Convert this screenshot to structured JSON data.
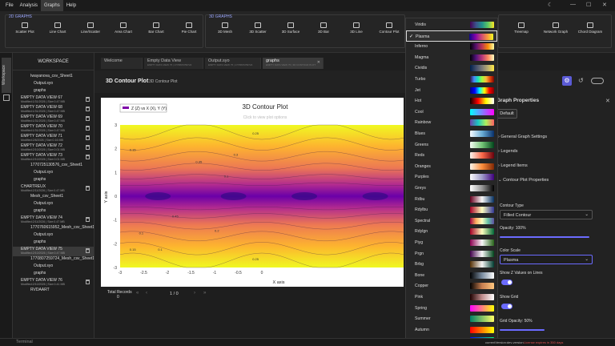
{
  "menubar": {
    "items": [
      "File",
      "Analysis",
      "Graphs",
      "Help"
    ],
    "active": "Graphs"
  },
  "ribbon": {
    "group2d": "2D GRAPHS",
    "group3d": "3D GRAPHS",
    "buttons2d": [
      "Scatter Plot",
      "Line Chart",
      "Line/Scatter",
      "Area Chart",
      "Bar Chart",
      "Pie Chart"
    ],
    "buttons3d": [
      "3D Mesh",
      "3D Scatter",
      "3D Surface",
      "3D Bar",
      "3D Line",
      "Contour Plot"
    ],
    "buttonsRight": [
      "Treemap",
      "Network Graph",
      "Chord Diagram"
    ]
  },
  "leftbar": {
    "workspace_tab": "Workspace"
  },
  "workspace": {
    "title": "WORKSPACE",
    "items": [
      {
        "label": "Iwayanova_csv_Sheet1",
        "sub": ""
      },
      {
        "label": "Output.syo",
        "sub": ""
      },
      {
        "label": "graphs",
        "sub": ""
      },
      {
        "label": "EMPTY DATA VIEW 67",
        "sub": "Modified:1/31/2026 | Size:0.47 MB"
      },
      {
        "label": "EMPTY DATA VIEW 68",
        "sub": "Modified:1/31/2026 | Size:0.47 MB"
      },
      {
        "label": "EMPTY DATA VIEW 69",
        "sub": "Modified:1/31/2026 | Size:0.47 MB"
      },
      {
        "label": "EMPTY DATA VIEW 70",
        "sub": "Modified:1/31/2026 | Size:0.47 MB"
      },
      {
        "label": "EMPTY DATA VIEW 71",
        "sub": "Modified:2/8/2026 | Size:0.16 MB"
      },
      {
        "label": "EMPTY DATA VIEW 72",
        "sub": "Modified:2/10/2026 | Size:0.01 MB"
      },
      {
        "label": "EMPTY DATA VIEW 73",
        "sub": "Modified:2/10/2026 | Size:0.01 MB"
      },
      {
        "label": "1770725130576_csv_Sheet1",
        "sub": ""
      },
      {
        "label": "Output.syo",
        "sub": ""
      },
      {
        "label": "graphs",
        "sub": ""
      },
      {
        "label": "CHARTREUX",
        "sub": "Modified:2/11/2026 | Size:0.47 MB"
      },
      {
        "label": "Mesh_csv_Sheet1",
        "sub": ""
      },
      {
        "label": "Output.syo",
        "sub": ""
      },
      {
        "label": "graphs",
        "sub": ""
      },
      {
        "label": "EMPTY DATA VIEW 74",
        "sub": "Modified:2/11/2026 | Size:0.47 MB"
      },
      {
        "label": "1770760615952_Mesh_csv_Sheet1",
        "sub": ""
      },
      {
        "label": "Output.syo",
        "sub": ""
      },
      {
        "label": "graphs",
        "sub": ""
      },
      {
        "label": "EMPTY DATA VIEW 75",
        "sub": "Modified:2/10/2026 | Size:0.47 MB"
      },
      {
        "label": "1770807259724_Mesh_csv_Sheet1",
        "sub": ""
      },
      {
        "label": "Output.syo",
        "sub": ""
      },
      {
        "label": "graphs",
        "sub": ""
      },
      {
        "label": "EMPTY DATA VIEW 76",
        "sub": "Modified:2/10/2026 | Size:0.41 MB"
      },
      {
        "label": "RVDAART",
        "sub": ""
      }
    ]
  },
  "tabs": [
    {
      "label": "Welcome",
      "sub": ""
    },
    {
      "label": "Empty Data View",
      "sub": "EMPTY DATA VIEW 75 | 1770807259724"
    },
    {
      "label": "Output.syo",
      "sub": "EMPTY DATA VIEW 75 | 1770807259724"
    },
    {
      "label": "graphs",
      "sub": "EMPTY DATA VIEW 75 | 3D CONTOUR PLOT"
    }
  ],
  "plotheader": {
    "title": "3D Contour Plot",
    "subtitle": "3D Contour Plot"
  },
  "chart_data": {
    "type": "heatmap",
    "title": "3D Contour Plot",
    "subtitle": "Click to view plot options",
    "legend": "Z (Z) vs X (X), Y (Y)",
    "xlabel": "X axis",
    "ylabel": "Y axis",
    "xlim": [
      -3,
      3
    ],
    "ylim": [
      -3,
      3
    ],
    "xticks": [
      "-3",
      "-2.5",
      "-2",
      "-1.5",
      "-1",
      "-0.5",
      "0"
    ],
    "yticks": [
      "3",
      "2",
      "1",
      "0",
      "-1",
      "-2",
      "-3"
    ],
    "contour_labels": [
      "0.25",
      "0.15",
      "0.35",
      "0.45",
      "0.1",
      "0.1",
      "0.25",
      "0.15",
      "0.1",
      "0.2",
      "0.3"
    ],
    "colorscale": "Plasma"
  },
  "footer": {
    "total_label": "Total Records",
    "total_value": "0",
    "page": "1 / 0"
  },
  "props": {
    "title": "Graph Properties",
    "default_btn": "Default",
    "sections": [
      "General Graph Settings",
      "Legends",
      "Legend Items",
      "Contour Plot Properties"
    ],
    "contour_type_label": "Contour Type",
    "contour_type_value": "Filled Contour",
    "opacity_label": "Opacity: 100%",
    "color_scale_label": "Color Scale",
    "color_scale_value": "Plasma",
    "show_z_label": "Show Z Values on Lines",
    "show_grid_label": "Show Grid",
    "grid_opacity_label": "Grid Opacity: 50%"
  },
  "colorscales": [
    {
      "name": "Viridis",
      "g": "linear-gradient(90deg,#440154,#3b528b,#21918c,#5ec962,#fde725)"
    },
    {
      "name": "Plasma",
      "g": "linear-gradient(90deg,#0d0887,#7e03a8,#cc4778,#f89540,#f0f921)"
    },
    {
      "name": "Inferno",
      "g": "linear-gradient(90deg,#000004,#57106e,#bc3754,#f98e09,#fcffa4)"
    },
    {
      "name": "Magma",
      "g": "linear-gradient(90deg,#000004,#51127c,#b73779,#fc8961,#fcfdbf)"
    },
    {
      "name": "Cividis",
      "g": "linear-gradient(90deg,#00204c,#414d6b,#7c7b78,#bcaf6f,#ffe945)"
    },
    {
      "name": "Turbo",
      "g": "linear-gradient(90deg,#30123b,#4686fb,#1ae4b6,#a2fc3c,#faba39,#e4460a,#7a0403)"
    },
    {
      "name": "Jet",
      "g": "linear-gradient(90deg,#000080,#0000ff,#00ffff,#ffff00,#ff0000,#800000)"
    },
    {
      "name": "Hot",
      "g": "linear-gradient(90deg,#0b0000,#ff0000,#ffff00,#ffffff)"
    },
    {
      "name": "Cool",
      "g": "linear-gradient(90deg,#00ffff,#ff00ff)"
    },
    {
      "name": "Rainbow",
      "g": "linear-gradient(90deg,#6e40aa,#1ac7c2,#aff05b,#ff5e63)"
    },
    {
      "name": "Blues",
      "g": "linear-gradient(90deg,#f7fbff,#6baed6,#08306b)"
    },
    {
      "name": "Greens",
      "g": "linear-gradient(90deg,#f7fcf5,#74c476,#00441b)"
    },
    {
      "name": "Reds",
      "g": "linear-gradient(90deg,#fff5f0,#fb6a4a,#67000d)"
    },
    {
      "name": "Oranges",
      "g": "linear-gradient(90deg,#fff5eb,#fd8d3c,#7f2704)"
    },
    {
      "name": "Purples",
      "g": "linear-gradient(90deg,#fcfbfd,#9e9ac8,#3f007d)"
    },
    {
      "name": "Greys",
      "g": "linear-gradient(90deg,#ffffff,#969696,#000000)"
    },
    {
      "name": "Rdbu",
      "g": "linear-gradient(90deg,#67001f,#f7f7f7,#053061)"
    },
    {
      "name": "Rdylbu",
      "g": "linear-gradient(90deg,#a50026,#ffffbf,#313695)"
    },
    {
      "name": "Spectral",
      "g": "linear-gradient(90deg,#9e0142,#fdae61,#ffffbf,#66c2a5,#5e4fa2)"
    },
    {
      "name": "Rdylgn",
      "g": "linear-gradient(90deg,#a50026,#ffffbf,#006837)"
    },
    {
      "name": "Piyg",
      "g": "linear-gradient(90deg,#8e0152,#f7f7f7,#276419)"
    },
    {
      "name": "Prgn",
      "g": "linear-gradient(90deg,#40004b,#f7f7f7,#00441b)"
    },
    {
      "name": "Brbg",
      "g": "linear-gradient(90deg,#543005,#f5f5f5,#003c30)"
    },
    {
      "name": "Bone",
      "g": "linear-gradient(90deg,#000000,#7a8ca0,#ffffff)"
    },
    {
      "name": "Copper",
      "g": "linear-gradient(90deg,#000000,#c87f50,#ffc77f)"
    },
    {
      "name": "Pink",
      "g": "linear-gradient(90deg,#1e0000,#c08c8c,#ffffff)"
    },
    {
      "name": "Spring",
      "g": "linear-gradient(90deg,#ff00ff,#ffff00)"
    },
    {
      "name": "Summer",
      "g": "linear-gradient(90deg,#008066,#ffff66)"
    },
    {
      "name": "Autumn",
      "g": "linear-gradient(90deg,#ff0000,#ffff00)"
    },
    {
      "name": "Winter",
      "g": "linear-gradient(90deg,#0000ff,#00ff80)"
    }
  ],
  "selected_scale": "Plasma",
  "statusbar": {
    "terminal": "Terminal",
    "version": "currentVersion:dev-version",
    "license": "License expires in 350 days"
  }
}
